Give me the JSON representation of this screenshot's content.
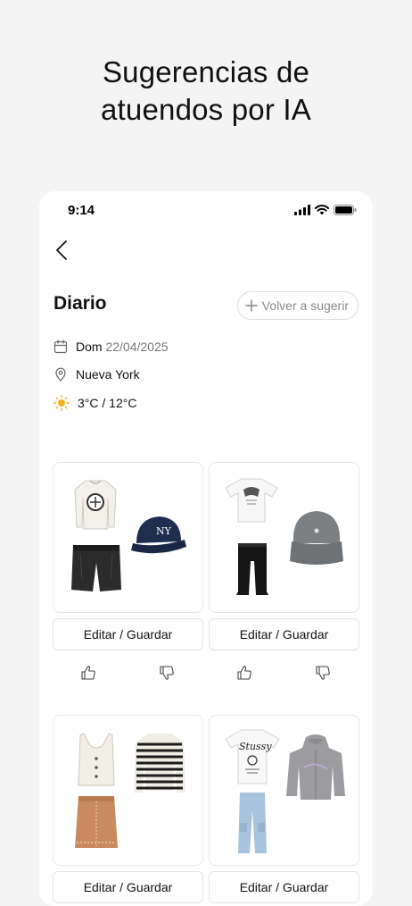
{
  "hero": {
    "line1": "Sugerencias de",
    "line2": "atuendos por IA"
  },
  "status_bar": {
    "time": "9:14"
  },
  "header": {
    "title": "Diario",
    "resuggest_label": "Volver a sugerir"
  },
  "info": {
    "day": "Dom",
    "date": "22/04/2025",
    "location": "Nueva York",
    "temperature": "3°C / 12°C"
  },
  "outfits": [
    {
      "items": [
        "cream-sweater",
        "navy-ny-cap",
        "black-leather-shorts"
      ],
      "action_label": "Editar / Guardar"
    },
    {
      "items": [
        "white-graphic-tee",
        "grey-cap",
        "black-joggers"
      ],
      "action_label": "Editar / Guardar"
    },
    {
      "items": [
        "cream-knit-vest",
        "striped-cardigan",
        "tan-skirt"
      ],
      "action_label": "Editar / Guardar"
    },
    {
      "items": [
        "white-stussy-tee",
        "grey-zip-hoodie",
        "light-blue-cargo-jeans"
      ],
      "action_label": "Editar / Guardar"
    }
  ],
  "colors": {
    "accent_sun": "#f2b01e",
    "text_muted": "#777777",
    "border": "#e6e6e6"
  }
}
